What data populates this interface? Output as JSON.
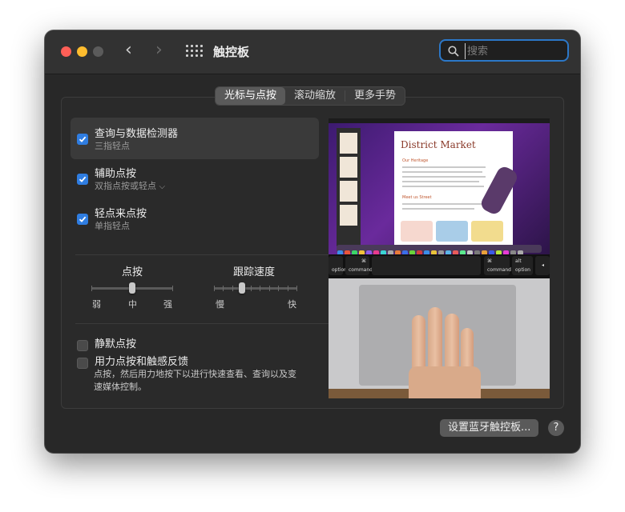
{
  "window": {
    "title": "触控板",
    "search": {
      "placeholder": "搜索",
      "value": ""
    }
  },
  "tabs": [
    {
      "label": "光标与点按",
      "active": true
    },
    {
      "label": "滚动缩放",
      "active": false
    },
    {
      "label": "更多手势",
      "active": false
    }
  ],
  "options": [
    {
      "title": "查询与数据检测器",
      "subtitle": "三指轻点",
      "checked": true,
      "selected": true
    },
    {
      "title": "辅助点按",
      "subtitle": "双指点按或轻点",
      "checked": true,
      "selected": false
    },
    {
      "title": "轻点来点按",
      "subtitle": "单指轻点",
      "checked": true,
      "selected": false
    }
  ],
  "click_slider": {
    "label": "点按",
    "ticks": [
      "弱",
      "中",
      "强"
    ],
    "value": "中"
  },
  "tracking_slider": {
    "label": "跟踪速度",
    "min_label": "慢",
    "max_label": "快",
    "value_fraction": 0.34
  },
  "silent_click": {
    "label": "静默点按",
    "checked": false
  },
  "force_click": {
    "label": "用力点按和触感反馈",
    "checked": false,
    "description": "点按，然后用力地按下以进行快速查看、查询以及变速媒体控制。"
  },
  "preview": {
    "doc_title": "District Market",
    "doc_heading": "Our Heritage",
    "doc_heading2": "Meet us Street",
    "keys": {
      "option_left": "option",
      "command_left": "command",
      "command_right": "command",
      "option_right": "option",
      "alt": "alt",
      "cmd_symbol": "⌘"
    }
  },
  "footer": {
    "bluetooth_button": "设置蓝牙触控板...",
    "help": "?"
  },
  "colors": {
    "accent": "#2f7de1",
    "window_bg": "#282828",
    "titlebar_bg": "#323232"
  }
}
